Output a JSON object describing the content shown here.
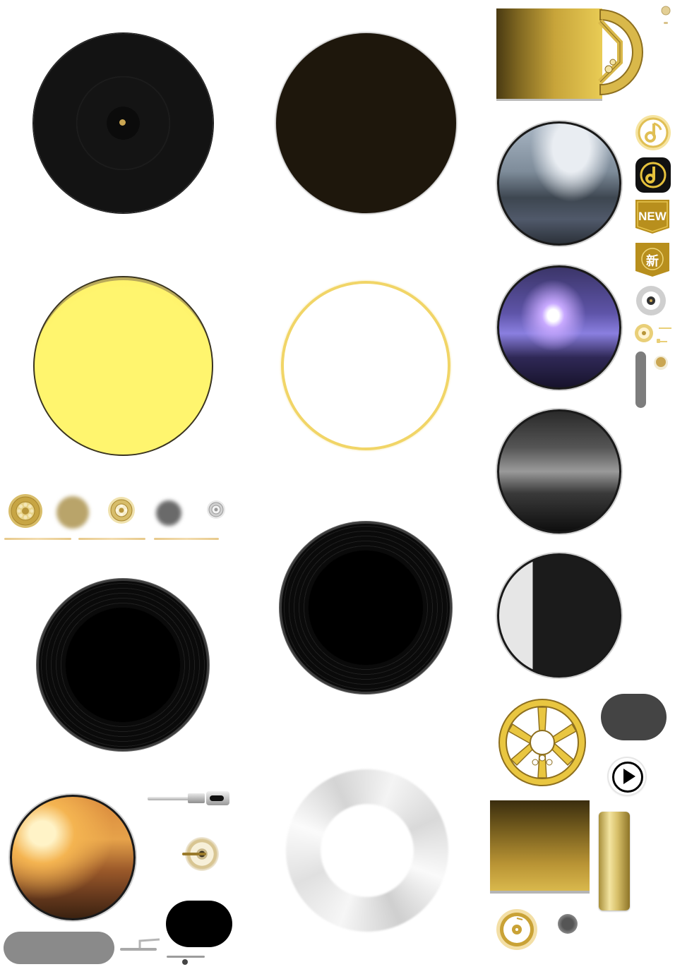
{
  "badges": {
    "new_label": "NEW",
    "xin_label": "新"
  },
  "colors": {
    "gold": "#c7a43a",
    "gold_light": "#f1d567",
    "yellow": "#fff56e",
    "dark_brown": "#1e170c",
    "gray": "#8a8a8a"
  },
  "icons": [
    "disc-icon",
    "music-note-icon",
    "gear-icon",
    "play-icon",
    "vinyl-record-icon",
    "reel-icon"
  ]
}
